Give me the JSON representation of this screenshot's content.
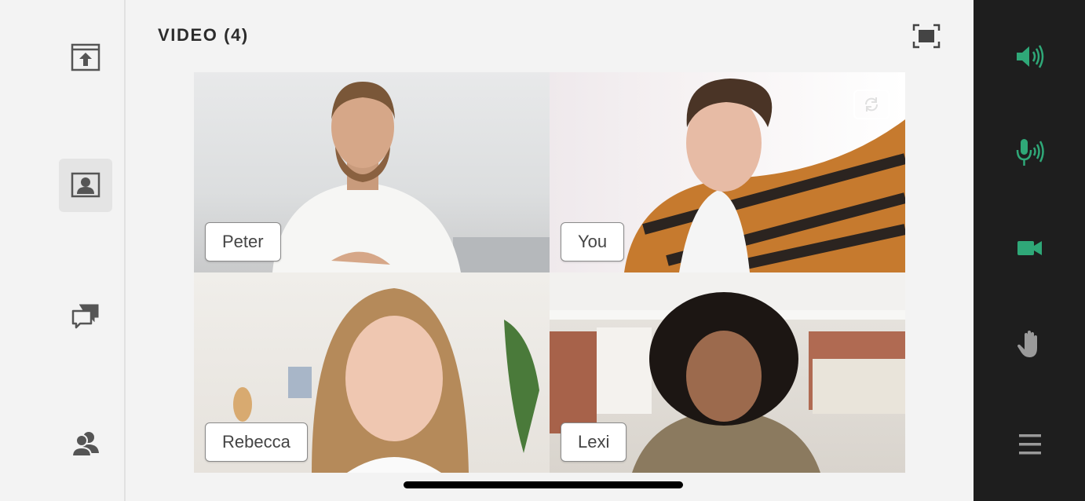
{
  "header": {
    "title": "VIDEO (4)"
  },
  "sidebar": {
    "items": [
      {
        "icon": "share-upload-icon"
      },
      {
        "icon": "video-person-icon",
        "active": true
      },
      {
        "icon": "chat-icon"
      },
      {
        "icon": "attendees-icon"
      }
    ]
  },
  "participants": [
    {
      "name": "Peter"
    },
    {
      "name": "You",
      "self": true
    },
    {
      "name": "Rebecca"
    },
    {
      "name": "Lexi"
    }
  ],
  "controls": {
    "items": [
      {
        "icon": "speaker-icon",
        "color": "#2fa878"
      },
      {
        "icon": "microphone-icon",
        "color": "#2fa878"
      },
      {
        "icon": "camera-icon",
        "color": "#2fa878"
      },
      {
        "icon": "raise-hand-icon",
        "color": "#9a9a9a"
      },
      {
        "icon": "menu-icon",
        "color": "#9a9a9a"
      }
    ]
  },
  "colors": {
    "accent": "#2fa878",
    "control_bar": "#1e1e1e",
    "background": "#f3f3f3"
  }
}
